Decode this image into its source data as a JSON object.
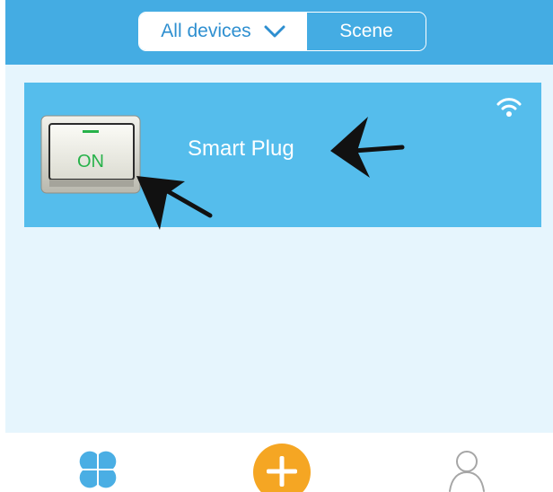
{
  "header": {
    "segments": {
      "all_devices_label": "All devices",
      "scene_label": "Scene"
    },
    "chevron_icon": "chevron-down-icon"
  },
  "device": {
    "name": "Smart Plug",
    "switch_label": "ON",
    "wifi_icon": "wifi-icon"
  },
  "tabbar": {
    "devices_icon": "devices-grid-icon",
    "add_icon": "add-icon",
    "profile_icon": "profile-icon"
  },
  "colors": {
    "header_bg": "#44ace3",
    "card_bg": "#55bdec",
    "content_bg": "#e6f5fd",
    "accent_orange": "#f5a623",
    "switch_text": "#27b24a"
  }
}
